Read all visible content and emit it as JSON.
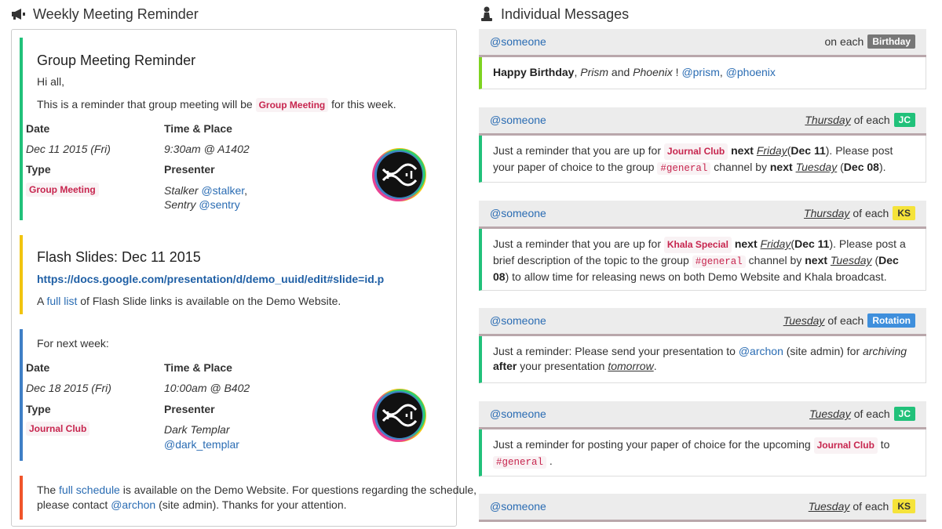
{
  "left_panel": {
    "title": "Weekly Meeting Reminder",
    "icon": "megaphone-icon",
    "group_meeting": {
      "heading": "Group Meeting Reminder",
      "greeting": "Hi all,",
      "intro_pre": "This is a reminder that group meeting will be",
      "intro_tag": "Group Meeting",
      "intro_post": "for this week.",
      "date_label": "Date",
      "date_value": "Dec 11 2015 (Fri)",
      "time_label": "Time & Place",
      "time_value": "9:30am @ A1402",
      "type_label": "Type",
      "type_value": "Group Meeting",
      "presenter_label": "Presenter",
      "presenter_1_name": "Stalker",
      "presenter_1_handle": "@stalker",
      "presenter_2_name": "Sentry",
      "presenter_2_handle": "@sentry"
    },
    "flash_slides": {
      "heading": "Flash Slides: Dec 11 2015",
      "url": "https://docs.google.com/presentation/d/demo_uuid/edit#slide=id.p",
      "text_pre": "A",
      "link": "full list",
      "text_post": "of Flash Slide links is available on the Demo Website."
    },
    "next_week": {
      "intro": "For next week:",
      "date_label": "Date",
      "date_value": "Dec 18 2015 (Fri)",
      "time_label": "Time & Place",
      "time_value": "10:00am @ B402",
      "type_label": "Type",
      "type_value": "Journal Club",
      "presenter_label": "Presenter",
      "presenter_name": "Dark Templar",
      "presenter_handle": "@dark_templar"
    },
    "footer": {
      "text_1": "The",
      "link": "full schedule",
      "text_2": "is available on the Demo Website. For questions regarding the schedule,",
      "text_3": "please contact",
      "contact": "@archon",
      "text_4": "(site admin). Thanks for your attention."
    }
  },
  "right_panel": {
    "title": "Individual Messages",
    "icon": "chess-pawn-icon",
    "cards": [
      {
        "user": "@someone",
        "day": "",
        "each": "on each",
        "badge": "Birthday",
        "badge_color": "#777777",
        "body": {
          "bold": "Happy Birthday",
          "comma": ",",
          "name1": "Prism",
          "and": "and",
          "name2": "Phoenix",
          "bang": "!",
          "handle1": "@prism",
          "sep": ",",
          "handle2": "@phoenix"
        }
      },
      {
        "user": "@someone",
        "day": "Thursday",
        "each": "of each",
        "badge": "JC",
        "badge_color": "#21c17a",
        "body": {
          "t1": "Just a reminder that you are up for",
          "tag": "Journal Club",
          "t2": "next",
          "day": "Friday",
          "t3": "(",
          "date": "Dec 11",
          "t4": "). Please post your paper of choice to the group",
          "channel": "#general",
          "t5": "channel by",
          "t6": "next",
          "day2": "Tuesday",
          "t7": "(",
          "date2": "Dec 08",
          "t8": ")."
        }
      },
      {
        "user": "@someone",
        "day": "Thursday",
        "each": "of each",
        "badge": "KS",
        "badge_color": "#f5e33a",
        "body": {
          "t1": "Just a reminder that you are up for",
          "tag": "Khala Special",
          "t2": "next",
          "day": "Friday",
          "t3": "(",
          "date": "Dec 11",
          "t4": "). Please post a brief description of the topic to the group",
          "channel": "#general",
          "t5": "channel by",
          "t6": "next",
          "day2": "Tuesday",
          "t7": "(",
          "date2": "Dec 08",
          "t8": ") to allow time for releasing news on both Demo Website and Khala broadcast."
        }
      },
      {
        "user": "@someone",
        "day": "Tuesday",
        "each": "of each",
        "badge": "Rotation",
        "badge_color": "#3f8fdc",
        "body": {
          "t1": "Just a reminder: Please send your presentation to",
          "handle": "@archon",
          "t2": "(site admin) for",
          "italic": "archiving",
          "bold": "after",
          "t3": "your presentation",
          "when": "tomorrow",
          "t4": "."
        }
      },
      {
        "user": "@someone",
        "day": "Tuesday",
        "each": "of each",
        "badge": "JC",
        "badge_color": "#21c17a",
        "body": {
          "t1": "Just a reminder for posting your paper of choice for the upcoming",
          "tag": "Journal Club",
          "t2": "to",
          "channel": "#general",
          "t3": "."
        }
      },
      {
        "user": "@someone",
        "day": "Tuesday",
        "each": "of each",
        "badge": "KS",
        "badge_color": "#f5e33a"
      }
    ]
  }
}
